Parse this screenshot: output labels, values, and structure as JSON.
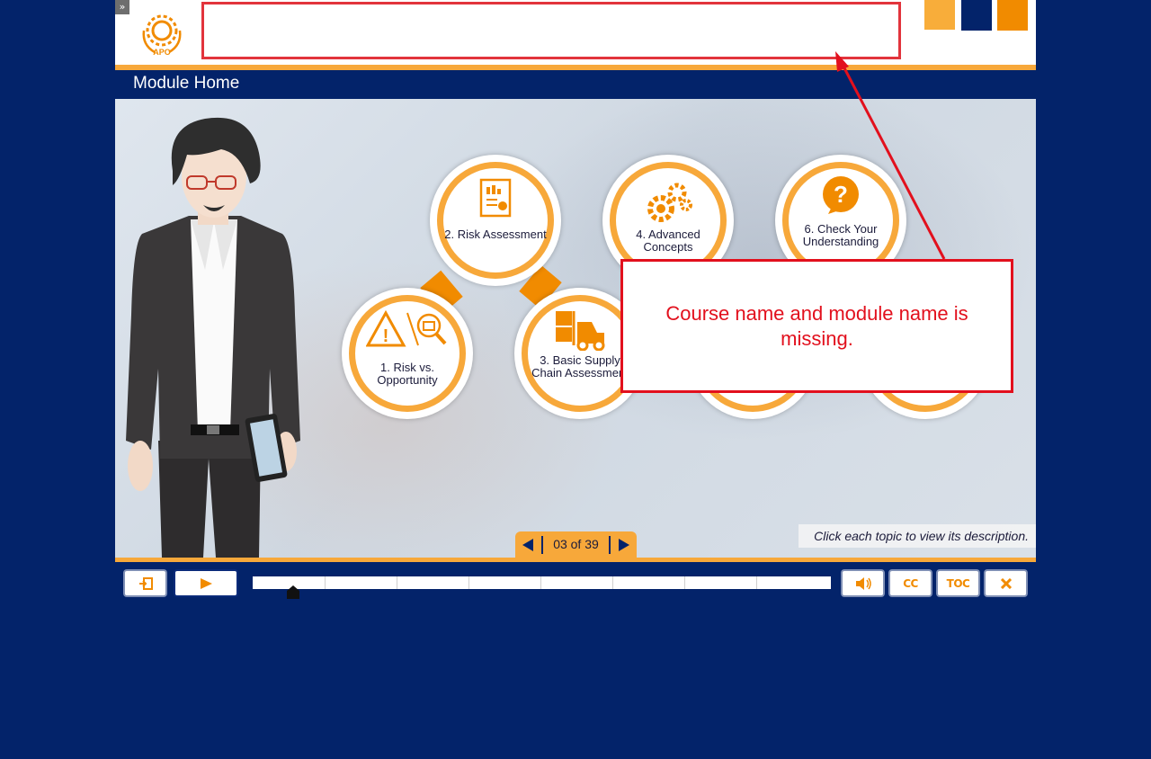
{
  "header": {
    "logo_text": "APO",
    "course_title": "",
    "accent_colors": [
      "#f8ad3a",
      "#03236a",
      "#f18b00"
    ]
  },
  "module": {
    "title": "Module Home"
  },
  "topics": [
    {
      "label": "1. Risk vs. Opportunity",
      "icon": "warning-search-icon"
    },
    {
      "label": "2. Risk Assessment",
      "icon": "report-icon"
    },
    {
      "label": "3. Basic Supply Chain Assessment",
      "icon": "forklift-icon"
    },
    {
      "label": "4. Advanced Concepts",
      "icon": "gears-icon"
    },
    {
      "label": "6. Check Your Understanding",
      "icon": "question-bubble-icon"
    }
  ],
  "hint": "Click each topic to view its description.",
  "pager": {
    "label": "03 of 39"
  },
  "callout": {
    "text": "Course name and module name is missing."
  },
  "controls": {
    "cc": "CC",
    "toc": "TOC",
    "progress_fraction": 0.07
  },
  "colors": {
    "background": "#03236a",
    "orange": "#f7a83a",
    "dark_orange": "#f18b00",
    "red": "#e2101d"
  }
}
